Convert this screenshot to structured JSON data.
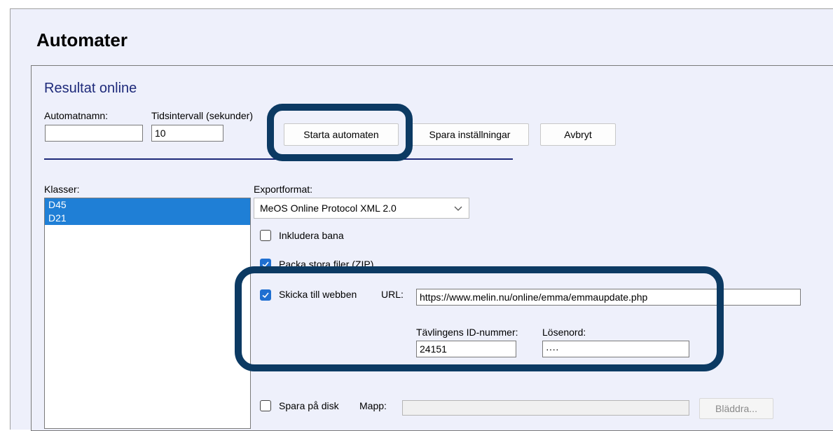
{
  "page_title": "Automater",
  "section_title": "Resultat online",
  "fields": {
    "automat_name_label": "Automatnamn:",
    "automat_name_value": "",
    "interval_label": "Tidsintervall (sekunder)",
    "interval_value": "10"
  },
  "buttons": {
    "start": "Starta automaten",
    "save": "Spara inställningar",
    "cancel": "Avbryt",
    "browse": "Bläddra..."
  },
  "classes": {
    "label": "Klasser:",
    "items": [
      "D45",
      "D21"
    ]
  },
  "export": {
    "label": "Exportformat:",
    "selected": "MeOS Online Protocol XML 2.0"
  },
  "options": {
    "include_course": "Inkludera bana",
    "pack_zip": "Packa stora filer (ZIP)",
    "send_web": "Skicka till webben",
    "url_label": "URL:",
    "url_value": "https://www.melin.nu/online/emma/emmaupdate.php",
    "competition_id_label": "Tävlingens ID-nummer:",
    "competition_id_value": "24151",
    "password_label": "Lösenord:",
    "password_value": "····",
    "save_disk": "Spara på disk",
    "folder_label": "Mapp:",
    "folder_value": ""
  },
  "colors": {
    "highlight": "#0c3a63",
    "selection": "#1f7fd6",
    "checkbox_checked": "#1f6fd1",
    "panel_bg": "#eef0fb"
  }
}
